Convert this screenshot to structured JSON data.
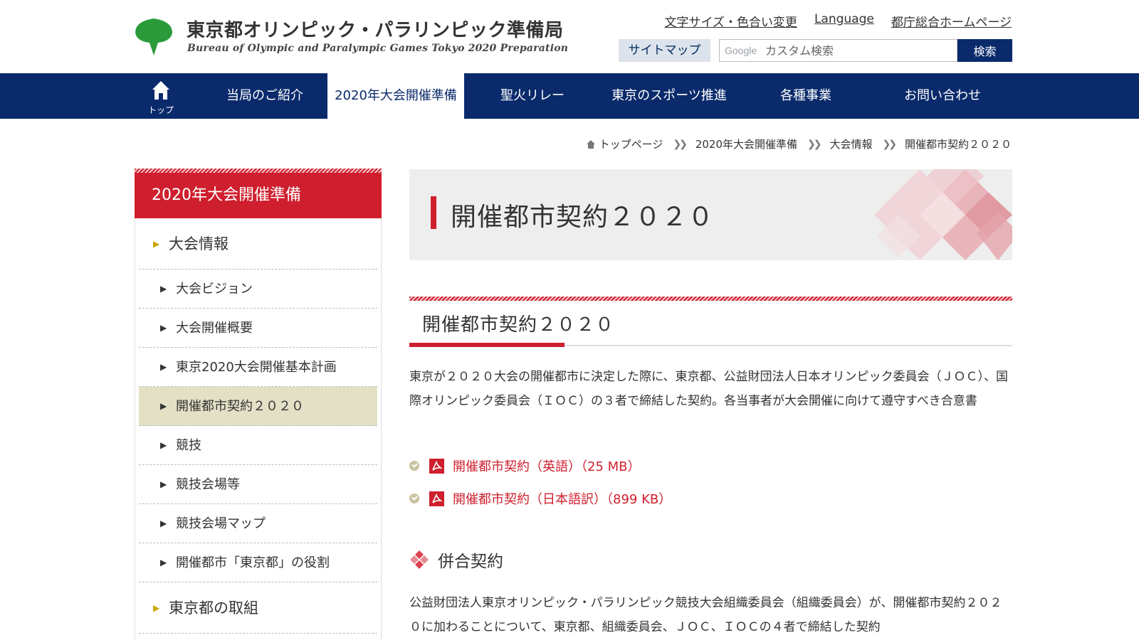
{
  "header": {
    "site_title": "東京都オリンピック・パラリンピック準備局",
    "site_subtitle": "Bureau of Olympic and Paralympic Games Tokyo 2020 Preparation",
    "util_links": [
      "文字サイズ・色合い変更",
      "Language",
      "都庁総合ホームページ"
    ],
    "sitemap_label": "サイトマップ",
    "search_brand": "Google",
    "search_placeholder": "カスタム検索",
    "search_button": "検索"
  },
  "nav": {
    "home_label": "トップ",
    "items": [
      "当局のご紹介",
      "2020年大会開催準備",
      "聖火リレー",
      "東京のスポーツ推進",
      "各種事業",
      "お問い合わせ"
    ],
    "active_index": 1
  },
  "breadcrumb": [
    "トップページ",
    "2020年大会開催準備",
    "大会情報",
    "開催都市契約２０２０"
  ],
  "sidebar": {
    "heading": "2020年大会開催準備",
    "items": [
      {
        "label": "大会情報",
        "level": "top"
      },
      {
        "label": "大会ビジョン",
        "level": "sub"
      },
      {
        "label": "大会開催概要",
        "level": "sub"
      },
      {
        "label": "東京2020大会開催基本計画",
        "level": "sub"
      },
      {
        "label": "開催都市契約２０２０",
        "level": "sub",
        "active": true
      },
      {
        "label": "競技",
        "level": "sub"
      },
      {
        "label": "競技会場等",
        "level": "sub"
      },
      {
        "label": "競技会場マップ",
        "level": "sub"
      },
      {
        "label": "開催都市「東京都」の役割",
        "level": "sub"
      },
      {
        "label": "東京都の取組",
        "level": "top"
      }
    ]
  },
  "main": {
    "page_title": "開催都市契約２０２０",
    "section_title": "開催都市契約２０２０",
    "description": "東京が２０２０大会の開催都市に決定した際に、東京都、公益財団法人日本オリンピック委員会（ＪＯＣ）、国際オリンピック委員会（ＩＯＣ）の３者で締結した契約。各当事者が大会開催に向けて遵守すべき合意書",
    "downloads": [
      {
        "label": "開催都市契約（英語）（25 MB）"
      },
      {
        "label": "開催都市契約（日本語訳）（899 KB）"
      }
    ],
    "subsection_title": "併合契約",
    "subsection_text": "公益財団法人東京オリンピック・パラリンピック競技大会組織委員会（組織委員会）が、開催都市契約２０２０に加わることについて、東京都、組織委員会、ＪＯＣ、ＩＯＣの４者で締結した契約"
  },
  "colors": {
    "navy": "#0a2a6b",
    "red": "#cf1f2e",
    "active_sidebar": "#e3e0c6",
    "logo_green": "#2a9a3b"
  }
}
